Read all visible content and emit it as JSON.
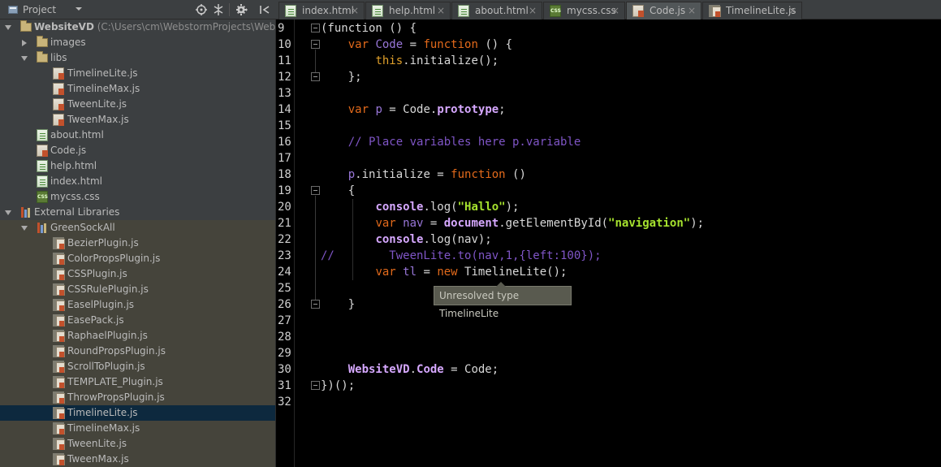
{
  "panel": {
    "title": "Project",
    "header_icons": [
      "target-icon",
      "collapse-icon",
      "gear-icon",
      "hide-icon"
    ]
  },
  "tree": [
    {
      "label": "WebsiteVD",
      "path": "(C:\\Users\\cm\\WebstormProjects\\Website",
      "indent": 0,
      "icon": "folder",
      "arrow": "down",
      "bold": true
    },
    {
      "label": "images",
      "indent": 1,
      "icon": "folder",
      "arrow": "right"
    },
    {
      "label": "libs",
      "indent": 1,
      "icon": "folder",
      "arrow": "down"
    },
    {
      "label": "TimelineLite.js",
      "indent": 2,
      "icon": "js"
    },
    {
      "label": "TimelineMax.js",
      "indent": 2,
      "icon": "js"
    },
    {
      "label": "TweenLite.js",
      "indent": 2,
      "icon": "js"
    },
    {
      "label": "TweenMax.js",
      "indent": 2,
      "icon": "js"
    },
    {
      "label": "about.html",
      "indent": 1,
      "icon": "html"
    },
    {
      "label": "Code.js",
      "indent": 1,
      "icon": "js"
    },
    {
      "label": "help.html",
      "indent": 1,
      "icon": "html"
    },
    {
      "label": "index.html",
      "indent": 1,
      "icon": "html"
    },
    {
      "label": "mycss.css",
      "indent": 1,
      "icon": "css"
    },
    {
      "label": "External Libraries",
      "indent": 0,
      "icon": "extlib",
      "arrow": "down"
    },
    {
      "label": "GreenSockAll",
      "indent": 1,
      "icon": "extlib",
      "arrow": "down",
      "ext": true
    },
    {
      "label": "BezierPlugin.js",
      "indent": 2,
      "icon": "libjs",
      "ext": true
    },
    {
      "label": "ColorPropsPlugin.js",
      "indent": 2,
      "icon": "libjs",
      "ext": true
    },
    {
      "label": "CSSPlugin.js",
      "indent": 2,
      "icon": "libjs",
      "ext": true
    },
    {
      "label": "CSSRulePlugin.js",
      "indent": 2,
      "icon": "libjs",
      "ext": true
    },
    {
      "label": "EaselPlugin.js",
      "indent": 2,
      "icon": "libjs",
      "ext": true
    },
    {
      "label": "EasePack.js",
      "indent": 2,
      "icon": "libjs",
      "ext": true
    },
    {
      "label": "RaphaelPlugin.js",
      "indent": 2,
      "icon": "libjs",
      "ext": true
    },
    {
      "label": "RoundPropsPlugin.js",
      "indent": 2,
      "icon": "libjs",
      "ext": true
    },
    {
      "label": "ScrollToPlugin.js",
      "indent": 2,
      "icon": "libjs",
      "ext": true
    },
    {
      "label": "TEMPLATE_Plugin.js",
      "indent": 2,
      "icon": "libjs",
      "ext": true
    },
    {
      "label": "ThrowPropsPlugin.js",
      "indent": 2,
      "icon": "libjs",
      "ext": true
    },
    {
      "label": "TimelineLite.js",
      "indent": 2,
      "icon": "libjs",
      "ext": true,
      "selected": true
    },
    {
      "label": "TimelineMax.js",
      "indent": 2,
      "icon": "libjs",
      "ext": true
    },
    {
      "label": "TweenLite.js",
      "indent": 2,
      "icon": "libjs",
      "ext": true
    },
    {
      "label": "TweenMax.js",
      "indent": 2,
      "icon": "libjs",
      "ext": true
    }
  ],
  "tabs": [
    {
      "label": "index.html",
      "icon": "html"
    },
    {
      "label": "help.html",
      "icon": "html"
    },
    {
      "label": "about.html",
      "icon": "html"
    },
    {
      "label": "mycss.css",
      "icon": "css"
    },
    {
      "label": "Code.js",
      "icon": "js",
      "active": true
    },
    {
      "label": "TimelineLite.js",
      "icon": "libjs"
    }
  ],
  "tab_close": "×",
  "editor": {
    "line_numbers": [
      "9",
      "10",
      "11",
      "12",
      "13",
      "14",
      "15",
      "16",
      "17",
      "18",
      "19",
      "20",
      "21",
      "22",
      "23",
      "24",
      "25",
      "26",
      "27",
      "28",
      "29",
      "30",
      "31",
      "32"
    ],
    "lines": [
      [
        [
          "n",
          "(function () {"
        ]
      ],
      [
        [
          "n",
          "    "
        ],
        [
          "k",
          "var "
        ],
        [
          "v",
          "Code"
        ],
        [
          "n",
          " = "
        ],
        [
          "k",
          "function"
        ],
        [
          "n",
          " () {"
        ]
      ],
      [
        [
          "n",
          "        "
        ],
        [
          "self",
          "this"
        ],
        [
          "n",
          ".initialize();"
        ]
      ],
      [
        [
          "n",
          "    };"
        ]
      ],
      [
        [
          "n",
          ""
        ]
      ],
      [
        [
          "n",
          "    "
        ],
        [
          "k",
          "var "
        ],
        [
          "v",
          "p"
        ],
        [
          "n",
          " = Code."
        ],
        [
          "b",
          "prototype"
        ],
        [
          "n",
          ";"
        ]
      ],
      [
        [
          "n",
          ""
        ]
      ],
      [
        [
          "c",
          "    // Place variables here p.variable"
        ]
      ],
      [
        [
          "n",
          ""
        ]
      ],
      [
        [
          "n",
          "    "
        ],
        [
          "v",
          "p"
        ],
        [
          "n",
          ".initialize = "
        ],
        [
          "k",
          "function"
        ],
        [
          "n",
          " ()"
        ]
      ],
      [
        [
          "n",
          "    {"
        ]
      ],
      [
        [
          "n",
          "        "
        ],
        [
          "b",
          "console"
        ],
        [
          "n",
          ".log("
        ],
        [
          "s",
          "\"Hallo\""
        ],
        [
          "n",
          ");"
        ]
      ],
      [
        [
          "n",
          "        "
        ],
        [
          "k",
          "var "
        ],
        [
          "v",
          "nav"
        ],
        [
          "n",
          " = "
        ],
        [
          "b",
          "document"
        ],
        [
          "n",
          ".getElementById("
        ],
        [
          "s",
          "\"navigation\""
        ],
        [
          "n",
          ");"
        ]
      ],
      [
        [
          "n",
          "        "
        ],
        [
          "b",
          "console"
        ],
        [
          "n",
          ".log(nav);"
        ]
      ],
      [
        [
          "c",
          "//        TweenLite.to(nav,1,{left:100});"
        ]
      ],
      [
        [
          "n",
          "        "
        ],
        [
          "k",
          "var "
        ],
        [
          "v",
          "tl"
        ],
        [
          "n",
          " = "
        ],
        [
          "k",
          "new "
        ],
        [
          "n",
          "TimelineLite();"
        ]
      ],
      [
        [
          "n",
          ""
        ]
      ],
      [
        [
          "n",
          "    }"
        ]
      ],
      [
        [
          "n",
          ""
        ]
      ],
      [
        [
          "n",
          ""
        ]
      ],
      [
        [
          "n",
          ""
        ]
      ],
      [
        [
          "n",
          "    "
        ],
        [
          "b",
          "WebsiteVD"
        ],
        [
          "n",
          "."
        ],
        [
          "b",
          "Code"
        ],
        [
          "n",
          " = Code;"
        ]
      ],
      [
        [
          "n",
          "})();"
        ]
      ],
      [
        [
          "n",
          ""
        ]
      ]
    ],
    "tooltip": "Unresolved type TimelineLite"
  }
}
